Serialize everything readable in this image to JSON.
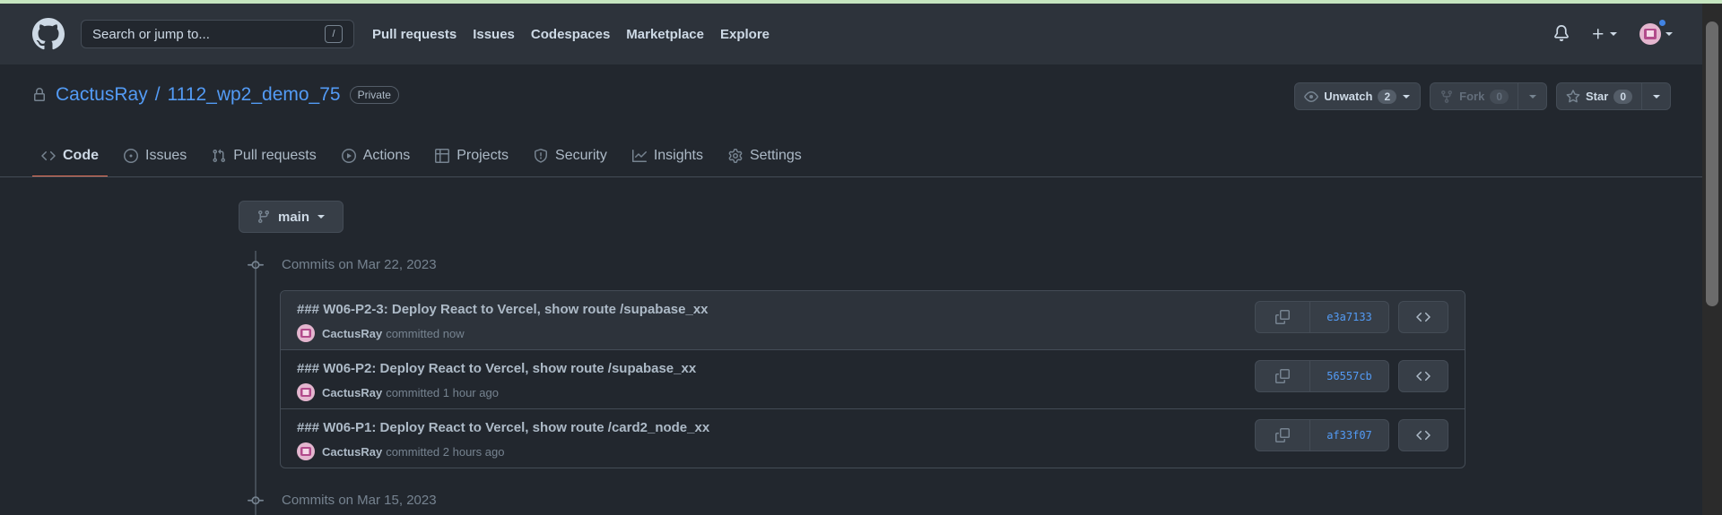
{
  "header": {
    "search_placeholder": "Search or jump to...",
    "search_shortcut": "/",
    "nav": [
      "Pull requests",
      "Issues",
      "Codespaces",
      "Marketplace",
      "Explore"
    ]
  },
  "repo": {
    "owner": "CactusRay",
    "separator": "/",
    "name": "1112_wp2_demo_75",
    "visibility": "Private",
    "watch_label": "Unwatch",
    "watch_count": "2",
    "fork_label": "Fork",
    "fork_count": "0",
    "star_label": "Star",
    "star_count": "0"
  },
  "tabs": [
    "Code",
    "Issues",
    "Pull requests",
    "Actions",
    "Projects",
    "Security",
    "Insights",
    "Settings"
  ],
  "branch": "main",
  "commit_groups": [
    {
      "date_label": "Commits on Mar 22, 2023",
      "commits": [
        {
          "message": "### W06-P2-3: Deploy React to Vercel, show route /supabase_xx",
          "author": "CactusRay",
          "time": "committed now",
          "sha": "e3a7133"
        },
        {
          "message": "### W06-P2: Deploy React to Vercel, show route /supabase_xx",
          "author": "CactusRay",
          "time": "committed 1 hour ago",
          "sha": "56557cb"
        },
        {
          "message": "### W06-P1: Deploy React to Vercel, show route /card2_node_xx",
          "author": "CactusRay",
          "time": "committed 2 hours ago",
          "sha": "af33f07"
        }
      ]
    },
    {
      "date_label": "Commits on Mar 15, 2023"
    }
  ],
  "colors": {
    "background": "#22272e",
    "header": "#2d333b",
    "link": "#539bf5",
    "active_tab_underline": "#ec775c",
    "notification_dot": "#4184e4"
  }
}
